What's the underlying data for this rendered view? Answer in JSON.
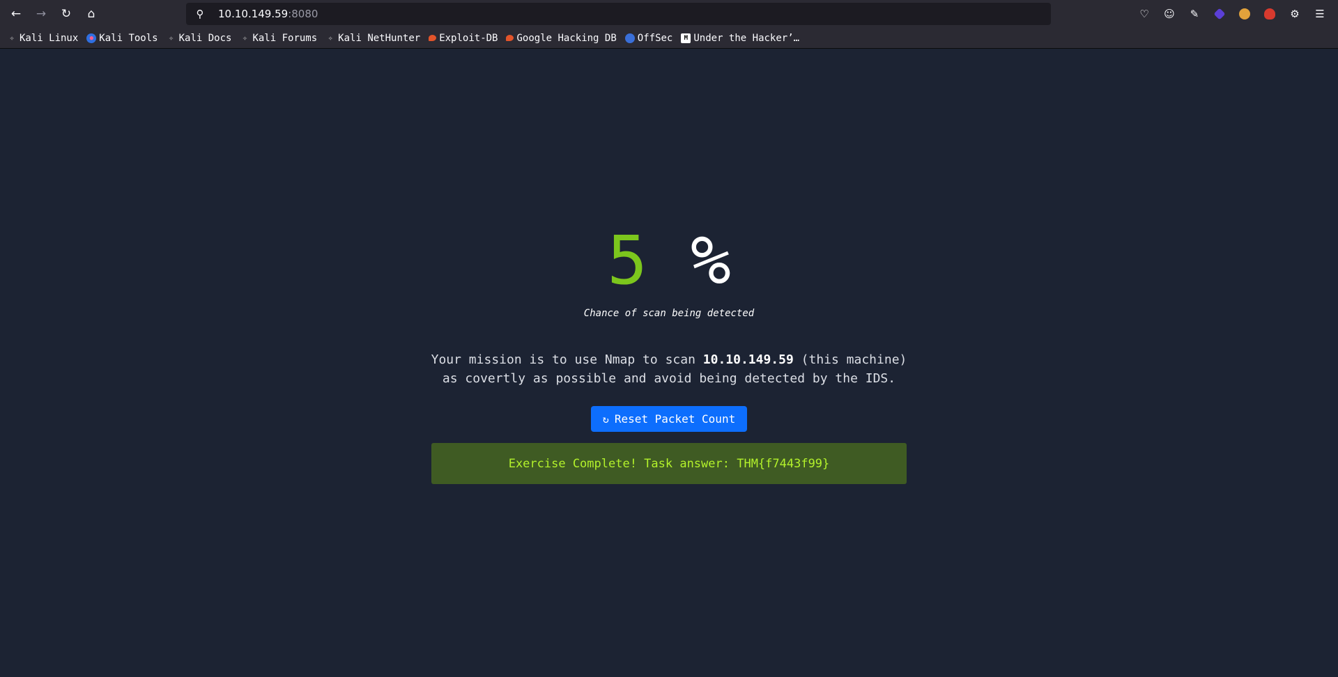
{
  "browser": {
    "url_host": "10.10.149.59",
    "url_port": ":8080"
  },
  "bookmarks": [
    {
      "label": "Kali Linux",
      "icon": "kali-dragon-icon"
    },
    {
      "label": "Kali Tools",
      "icon": "kali-tools-icon"
    },
    {
      "label": "Kali Docs",
      "icon": "kali-dragon-icon"
    },
    {
      "label": "Kali Forums",
      "icon": "kali-dragon-icon"
    },
    {
      "label": "Kali NetHunter",
      "icon": "kali-dragon-icon"
    },
    {
      "label": "Exploit-DB",
      "icon": "exploit-db-icon"
    },
    {
      "label": "Google Hacking DB",
      "icon": "exploit-db-icon"
    },
    {
      "label": "OffSec",
      "icon": "offsec-icon"
    },
    {
      "label": "Under the Hacker’…",
      "icon": "medium-icon"
    }
  ],
  "detection": {
    "value": "5",
    "unit": "%",
    "caption": "Chance of scan being detected"
  },
  "mission": {
    "line1_prefix": "Your mission is to use Nmap to scan ",
    "target_ip": "10.10.149.59",
    "line1_suffix": " (this machine)",
    "line2": "as covertly as possible and avoid being detected by the IDS."
  },
  "reset_button": {
    "label": "Reset Packet Count"
  },
  "result": {
    "message": "Exercise Complete! Task answer: THM{f7443f99}"
  },
  "colors": {
    "page_bg": "#1c2333",
    "percent_green": "#7cc61d",
    "button_blue": "#0d6efd",
    "success_bg": "#3f5b23",
    "success_text": "#b3f22b"
  }
}
